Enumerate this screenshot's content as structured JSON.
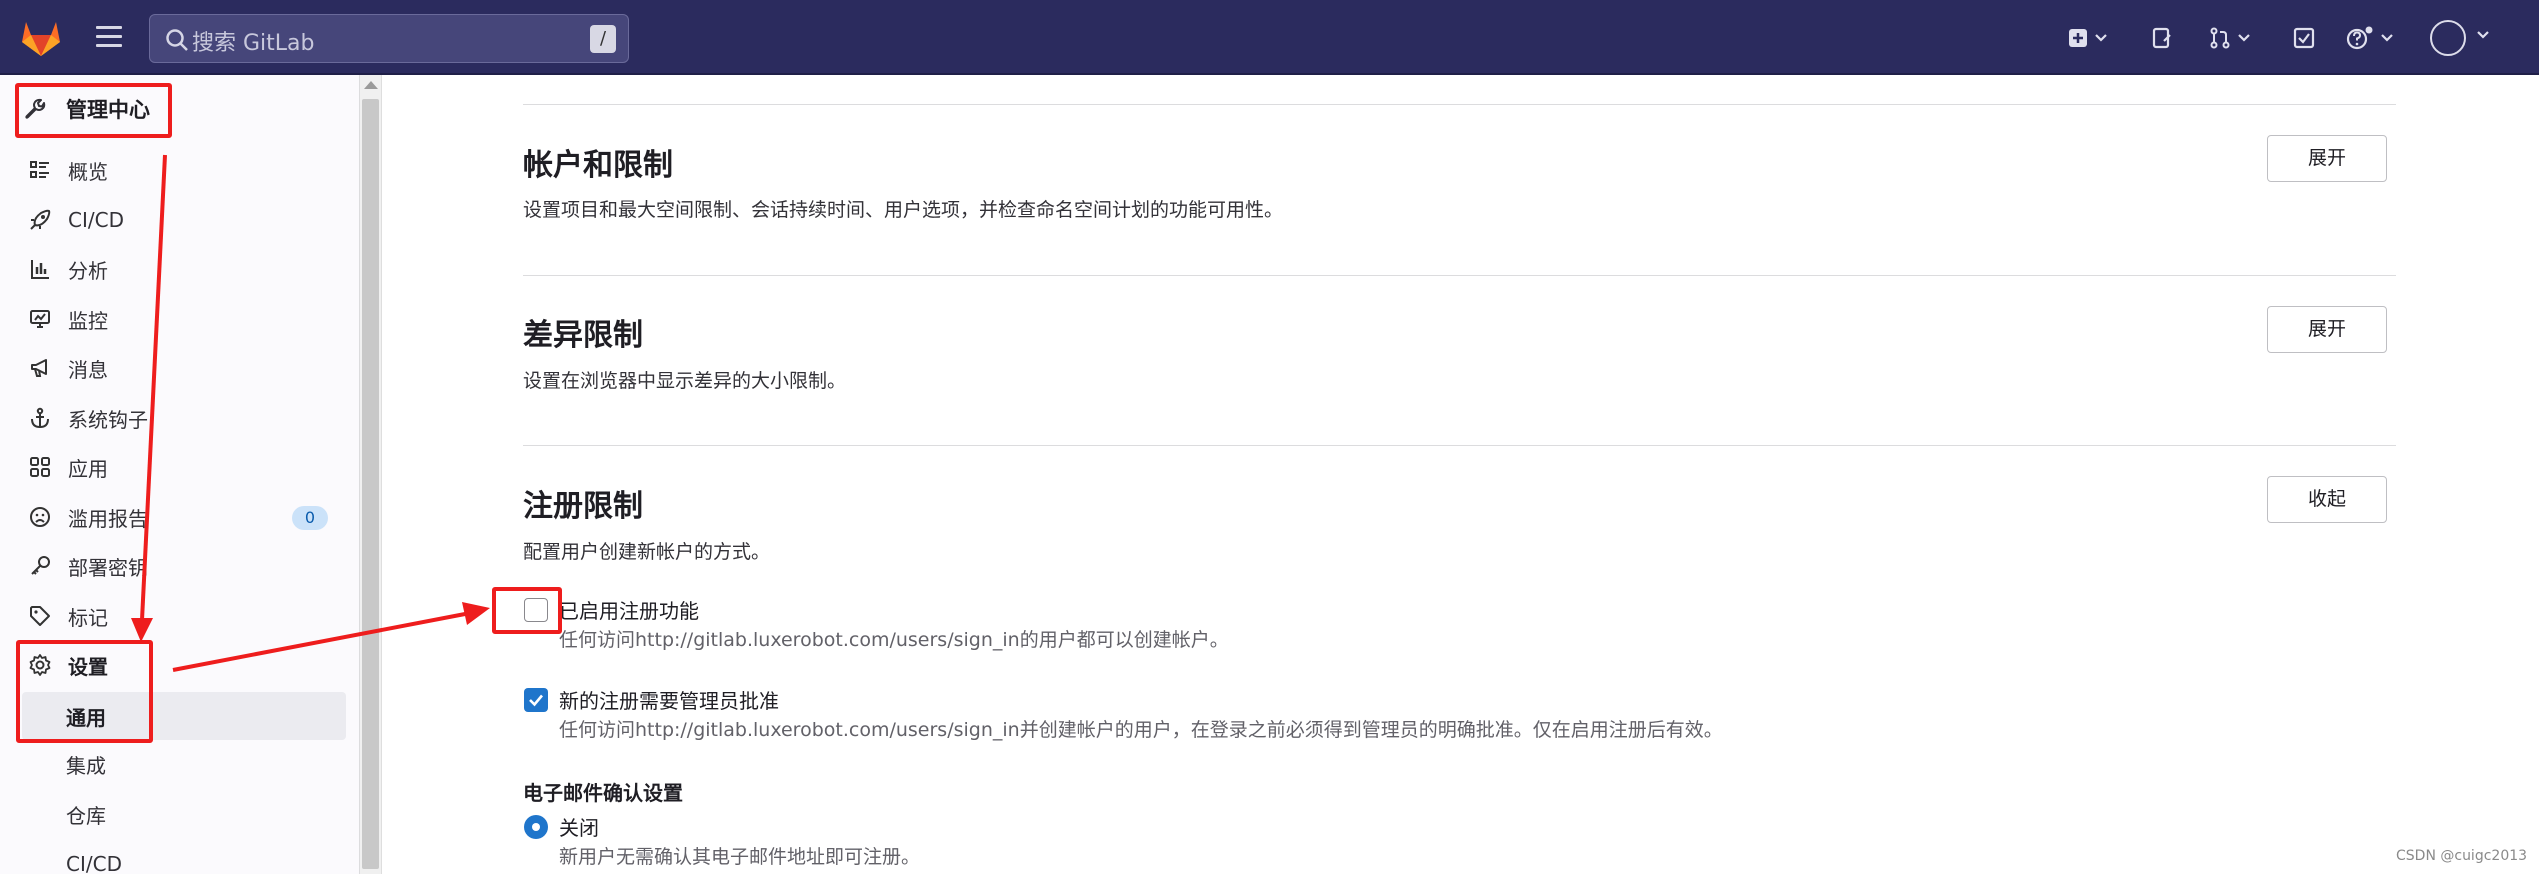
{
  "search": {
    "placeholder": "搜索 GitLab",
    "shortcut": "/"
  },
  "sidebar": {
    "header": "管理中心",
    "items": [
      {
        "label": "概览",
        "icon": "overview-icon"
      },
      {
        "label": "CI/CD",
        "icon": "rocket-icon"
      },
      {
        "label": "分析",
        "icon": "chart-icon"
      },
      {
        "label": "监控",
        "icon": "monitor-icon"
      },
      {
        "label": "消息",
        "icon": "bullhorn-icon"
      },
      {
        "label": "系统钩子",
        "icon": "anchor-icon"
      },
      {
        "label": "应用",
        "icon": "apps-icon"
      },
      {
        "label": "滥用报告",
        "icon": "sad-face-icon",
        "badge": "0"
      },
      {
        "label": "部署密钥",
        "icon": "key-icon"
      },
      {
        "label": "标记",
        "icon": "label-icon"
      },
      {
        "label": "设置",
        "icon": "gear-icon"
      }
    ],
    "settings_sub": [
      "通用",
      "集成",
      "仓库",
      "CI/CD"
    ]
  },
  "sections": [
    {
      "title": "帐户和限制",
      "desc": "设置项目和最大空间限制、会话持续时间、用户选项，并检查命名空间计划的功能可用性。",
      "button": "展开"
    },
    {
      "title": "差异限制",
      "desc": "设置在浏览器中显示差异的大小限制。",
      "button": "展开"
    },
    {
      "title": "注册限制",
      "desc": "配置用户创建新帐户的方式。",
      "button": "收起"
    }
  ],
  "signup": {
    "enabled_label": "已启用注册功能",
    "enabled_checked": false,
    "enabled_help": "任何访问http://gitlab.luxerobot.com/users/sign_in的用户都可以创建帐户。",
    "approval_label": "新的注册需要管理员批准",
    "approval_checked": true,
    "approval_help": "任何访问http://gitlab.luxerobot.com/users/sign_in并创建帐户的用户，在登录之前必须得到管理员的明确批准。仅在启用注册后有效。",
    "email_confirm_heading": "电子邮件确认设置",
    "email_confirm_option": "关闭",
    "email_confirm_help": "新用户无需确认其电子邮件地址即可注册。"
  },
  "watermark": "CSDN @cuigc2013",
  "colors": {
    "topbar": "#2b2b5e",
    "accent": "#1f75cb",
    "annotation": "#ee1d1d"
  }
}
